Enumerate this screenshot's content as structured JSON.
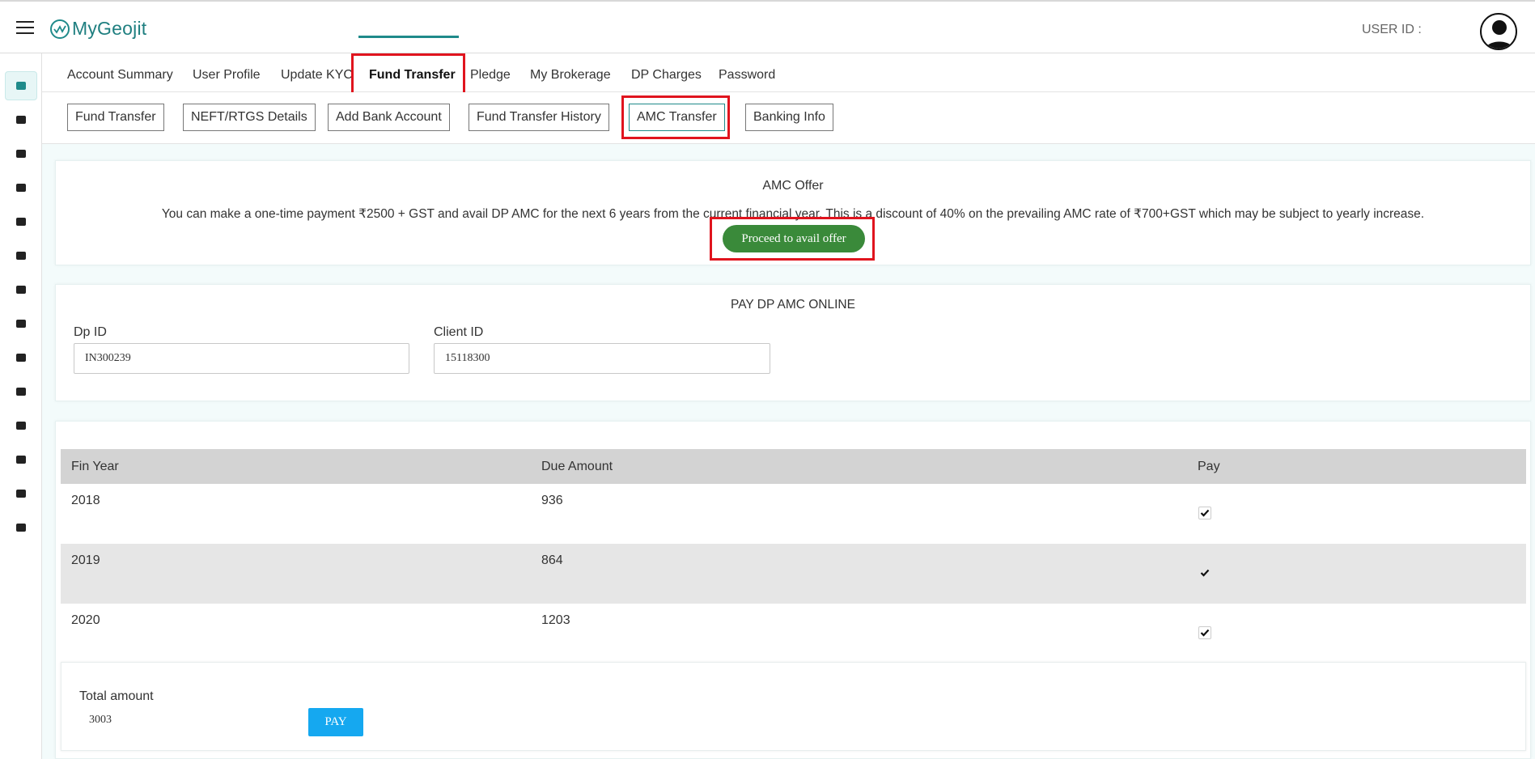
{
  "header": {
    "brand": "MyGeojit",
    "user_id_label": "USER ID :"
  },
  "sidebar": {
    "icons": [
      "wallet-icon",
      "ipo-icon",
      "books-icon",
      "bar-chart-icon",
      "hand-coin-icon",
      "ipo-badge-icon",
      "network-icon",
      "car-icon",
      "people-icon",
      "mobile-icon",
      "bull-icon",
      "phone-icon",
      "growth-chart-icon",
      "headset-icon"
    ]
  },
  "tabs": [
    "Account Summary",
    "User Profile",
    "Update KYC",
    "Fund Transfer",
    "Pledge",
    "My Brokerage",
    "DP Charges",
    "Password"
  ],
  "active_tab": "Fund Transfer",
  "subtabs": [
    "Fund Transfer",
    "NEFT/RTGS Details",
    "Add Bank Account",
    "Fund Transfer History",
    "AMC Transfer",
    "Banking Info"
  ],
  "active_subtab": "AMC Transfer",
  "offer": {
    "title": "AMC Offer",
    "text": "You can make a one-time payment ₹2500 + GST and avail DP AMC for the next 6 years from the current financial year. This is a discount of 40% on the prevailing AMC rate of ₹700+GST which may be subject to yearly increase.",
    "button": "Proceed to avail offer"
  },
  "pay_online": {
    "title": "PAY DP AMC ONLINE",
    "dp_id_label": "Dp ID",
    "dp_id_value": "IN300239",
    "client_id_label": "Client ID",
    "client_id_value": "15118300"
  },
  "table": {
    "headers": [
      "Fin Year",
      "Due Amount",
      "Pay"
    ],
    "rows": [
      {
        "year": "2018",
        "amount": "936",
        "checked": true
      },
      {
        "year": "2019",
        "amount": "864",
        "checked": true
      },
      {
        "year": "2020",
        "amount": "1203",
        "checked": true
      }
    ]
  },
  "total": {
    "label": "Total amount",
    "value": "3003",
    "pay_button": "PAY"
  },
  "colors": {
    "brand": "#1f7f80",
    "offer_button": "#3a8a3a",
    "pay_button": "#15a8f0",
    "highlight": "#e0141e"
  }
}
